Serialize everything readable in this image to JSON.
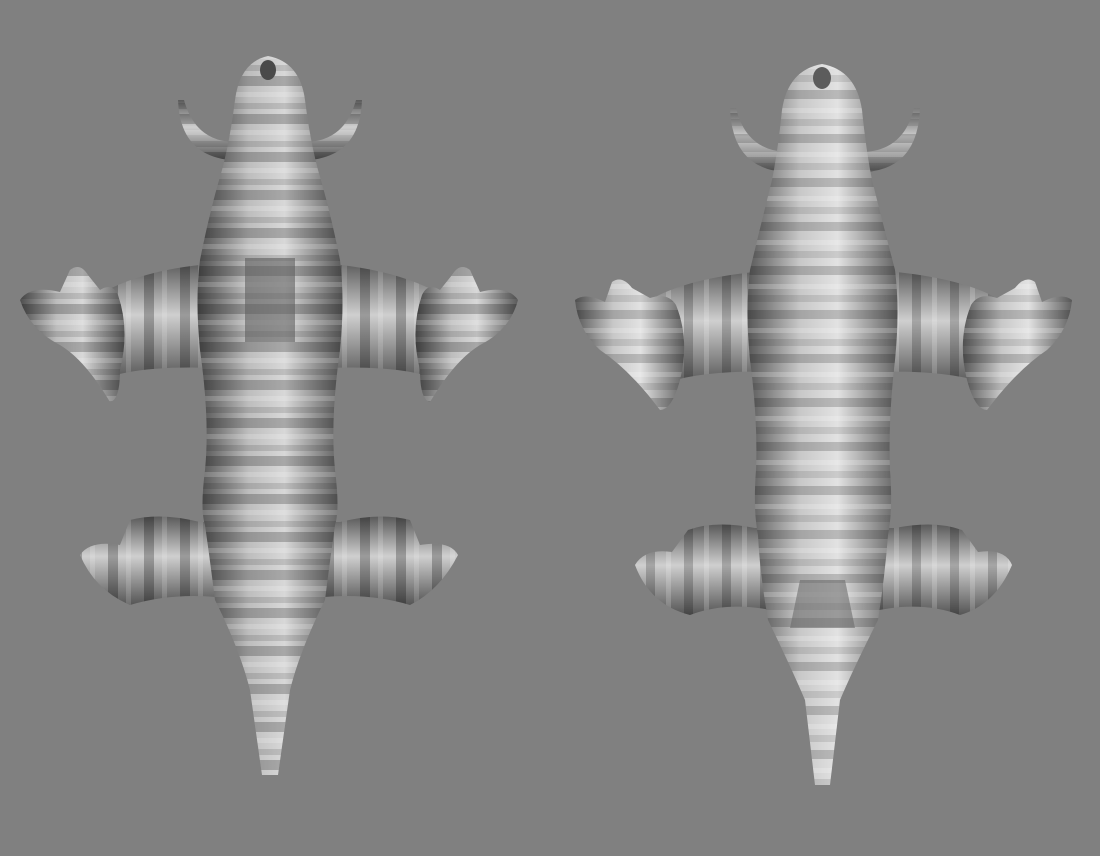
{
  "scene": {
    "background": "#808080",
    "figures": [
      {
        "name": "figure-left",
        "palette": {
          "light": "#d4d4d4",
          "mid": "#a3a3a3",
          "dark": "#6a6a6a"
        }
      },
      {
        "name": "figure-right",
        "palette": {
          "light": "#dedede",
          "mid": "#b0b0b0",
          "dark": "#737373"
        }
      }
    ]
  }
}
